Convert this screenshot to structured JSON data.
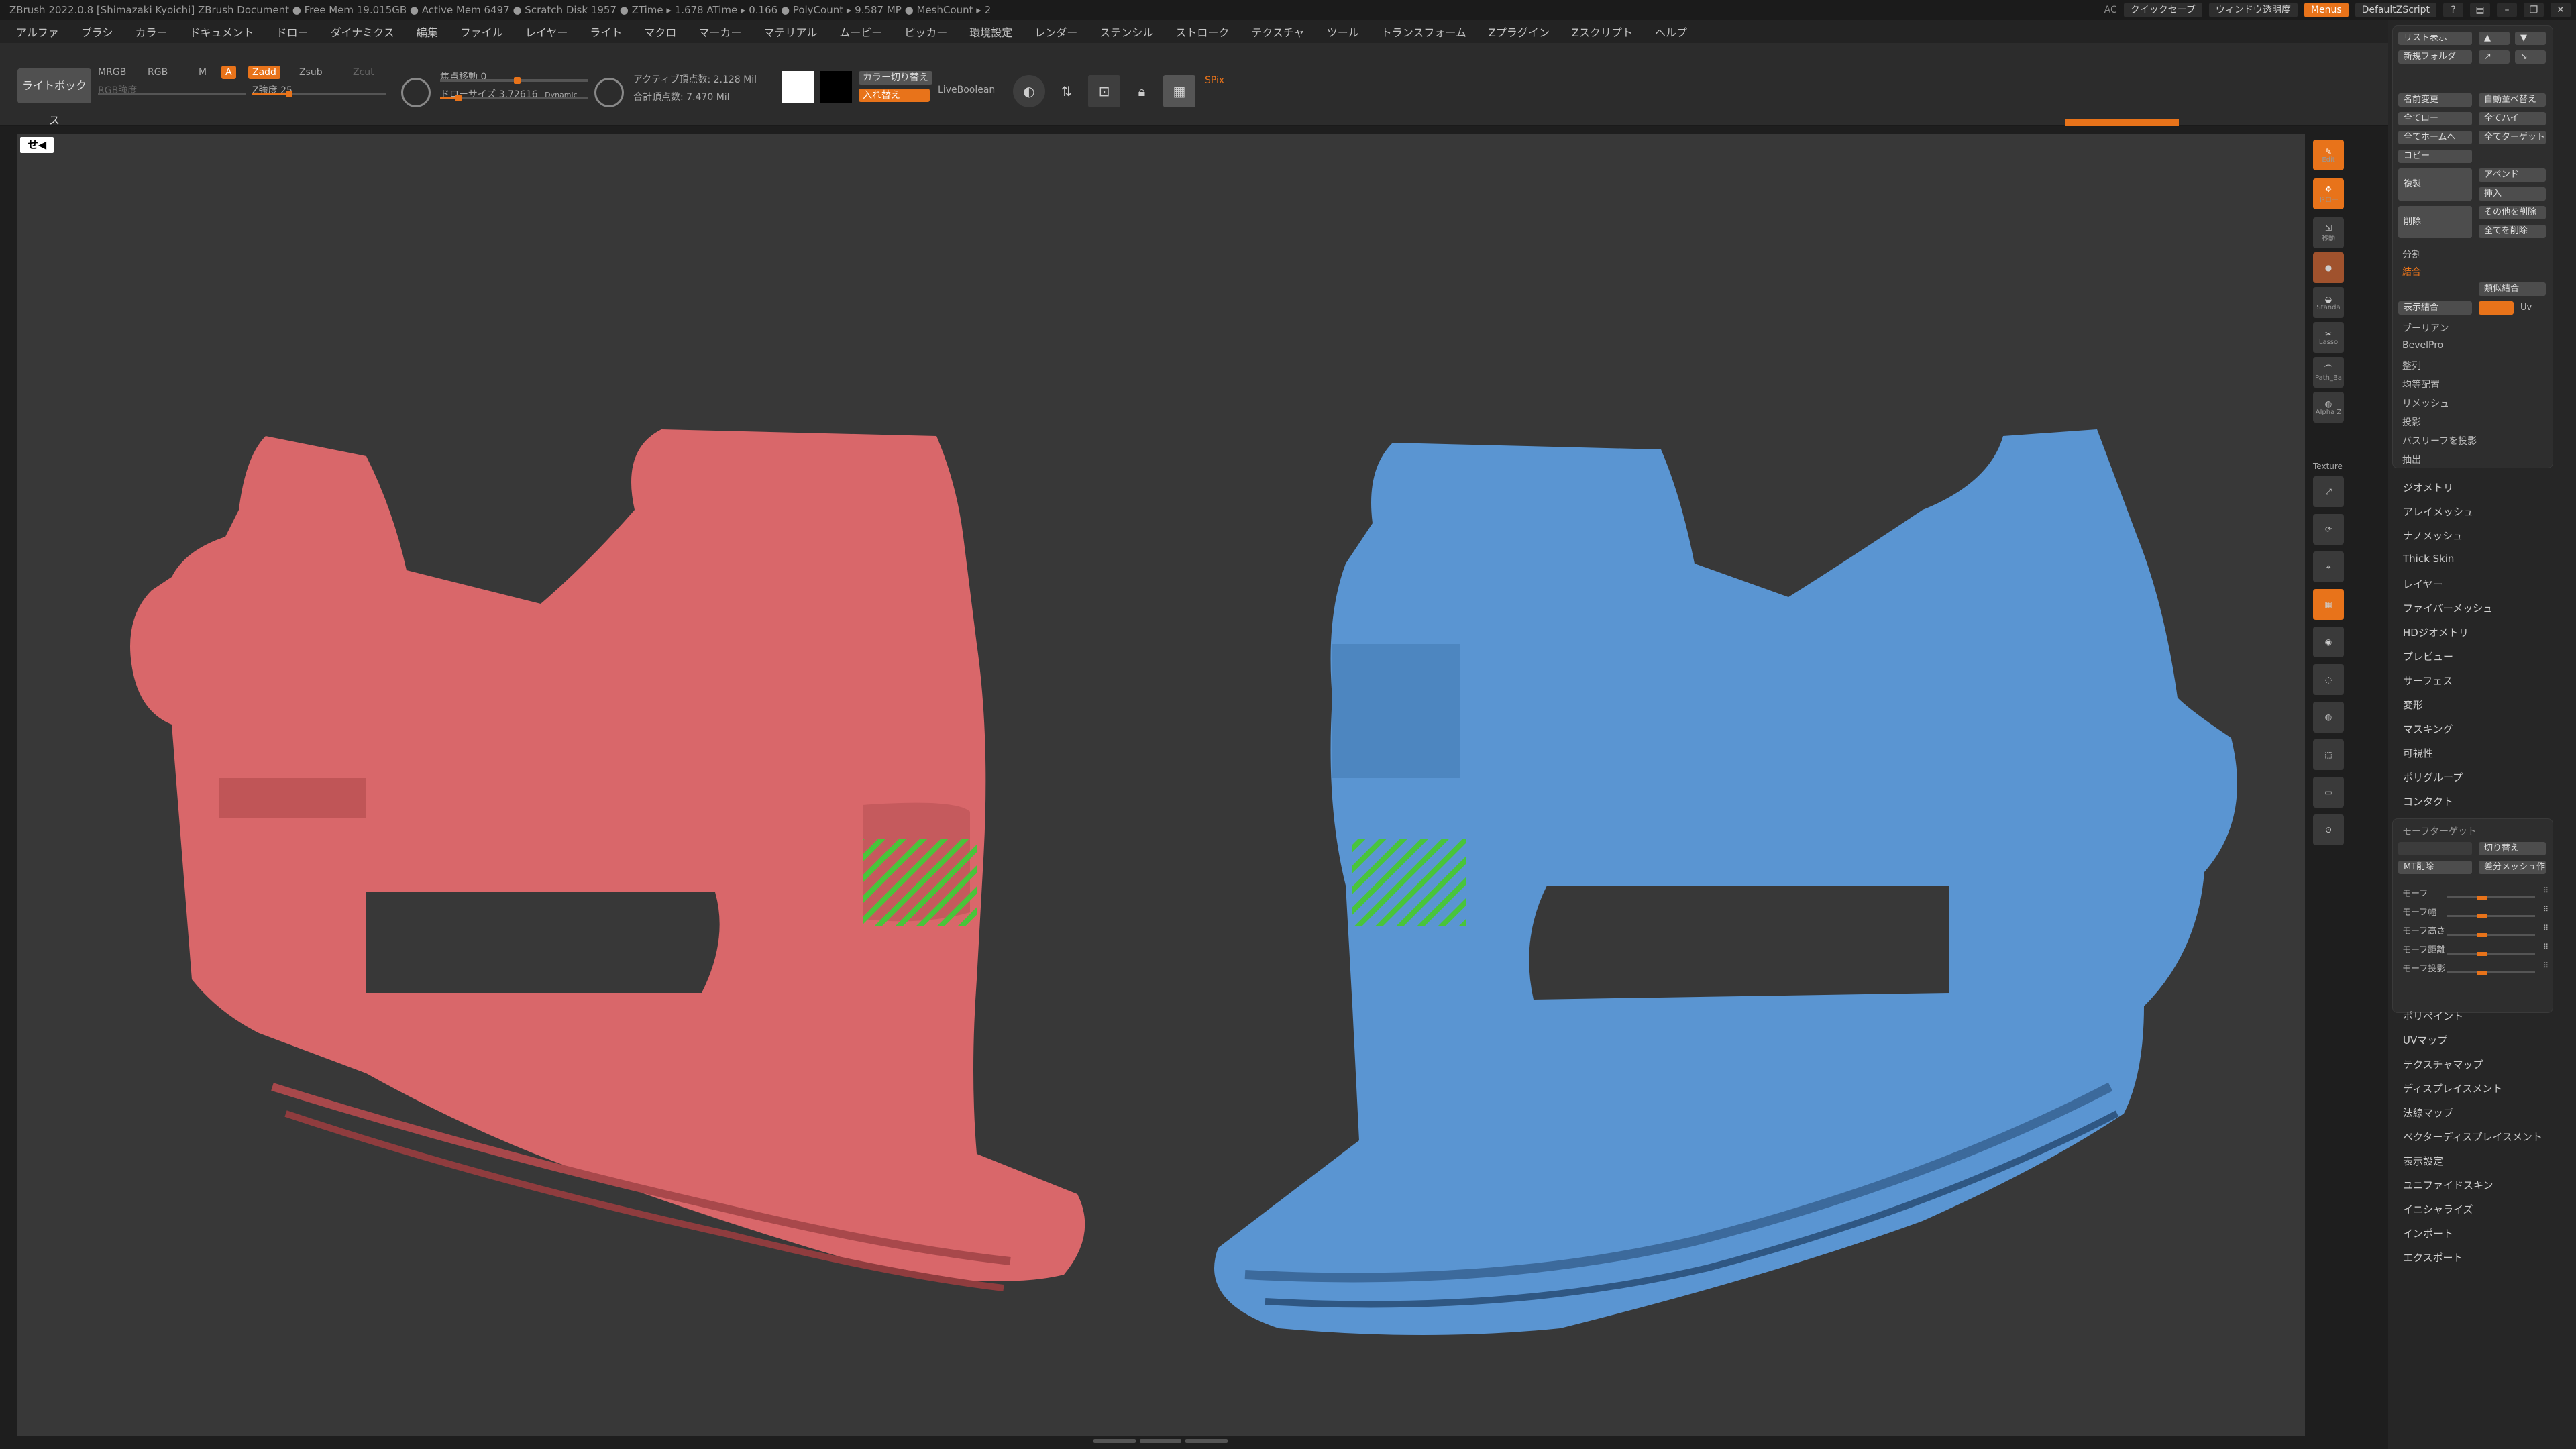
{
  "titlebar": {
    "text": "ZBrush 2022.0.8 [Shimazaki Kyoichi]   ZBrush Document   ● Free Mem 19.015GB ● Active Mem 6497 ● Scratch Disk 1957 ● ZTime ▸ 1.678 ATime ▸ 0.166 ● PolyCount ▸ 9.587 MP ● MeshCount ▸ 2",
    "ac": "AC",
    "quicksave": "クイックセーブ",
    "transparency": "ウィンドウ透明度",
    "menus": "Menus",
    "script": "DefaultZScript"
  },
  "menubar": [
    "アルファ",
    "ブラシ",
    "カラー",
    "ドキュメント",
    "ドロー",
    "ダイナミクス",
    "編集",
    "ファイル",
    "レイヤー",
    "ライト",
    "マクロ",
    "マーカー",
    "マテリアル",
    "ムービー",
    "ピッカー",
    "環境設定",
    "レンダー",
    "ステンシル",
    "ストローク",
    "テクスチャ",
    "ツール",
    "トランスフォーム",
    "Zプラグイン",
    "Zスクリプト",
    "ヘルプ"
  ],
  "toolbar": {
    "lightbox": "ライトボックス",
    "mrgb": "MRGB",
    "rgb": "RGB",
    "m": "M",
    "a": "A",
    "zadd": "Zadd",
    "zsub": "Zsub",
    "zcut": "Zcut",
    "rgb_intensity": "RGB強度",
    "z_intensity": "Z強度 25",
    "focal_shift": "焦点移動 0",
    "draw_size": "ドローサイズ 3.72616",
    "dynamic": "Dynamic",
    "active_points": "アクティブ頂点数: 2.128 Mil",
    "total_points": "合計頂点数: 7.470 Mil",
    "color_switch": "カラー切り替え",
    "swap": "入れ替え",
    "liveboolean": "LiveBoolean",
    "spix": "SPix",
    "z_intensity_value": 0.25,
    "focal_shift_value": 0.5,
    "draw_size_value": 0.1
  },
  "viewport": {
    "label": "せ◀"
  },
  "vtoolbar": [
    {
      "label": "Edit",
      "name": "edit-button"
    },
    {
      "label": "ドロー",
      "name": "draw-button"
    },
    {
      "label": "移動",
      "name": "move-button"
    },
    {
      "label": "",
      "name": "material-button"
    },
    {
      "label": "Standa",
      "name": "standard-brush-button"
    },
    {
      "label": "Lasso",
      "name": "lasso-button"
    },
    {
      "label": "Path_Ba",
      "name": "path-button"
    },
    {
      "label": "Alpha Z",
      "name": "alpha-button"
    }
  ],
  "vtoolbar_texture": "Texture",
  "rightpanel": {
    "list_view": "リスト表示",
    "new_folder": "新規フォルダ",
    "rename": "名前変更",
    "auto_sort": "自動並べ替え",
    "all_low": "全てロー",
    "all_high": "全てハイ",
    "all_home": "全てホームへ",
    "all_target": "全てターゲット",
    "copy": "コピー",
    "duplicate": "複製",
    "append": "アペンド",
    "insert": "挿入",
    "delete": "削除",
    "delete_others": "その他を削除",
    "delete_all": "全てを削除",
    "split": "分割",
    "merge": "結合",
    "merge_similar": "類似結合",
    "visible_merge": "表示結合",
    "uv": "Uv",
    "boolean": "ブーリアン",
    "bevelpro": "BevelPro",
    "align": "整列",
    "distribute": "均等配置",
    "remesh": "リメッシュ",
    "project": "投影",
    "project_bas": "バスリーフを投影",
    "extract": "抽出",
    "menus": [
      "ジオメトリ",
      "アレイメッシュ",
      "ナノメッシュ",
      "Thick Skin",
      "レイヤー",
      "ファイバーメッシュ",
      "HDジオメトリ",
      "プレビュー",
      "サーフェス",
      "変形",
      "マスキング",
      "可視性",
      "ポリグループ",
      "コンタクト"
    ],
    "morph_target": "モーフターゲット",
    "switch": "切り替え",
    "mt_delete": "MT削除",
    "diff_mesh": "差分メッシュ作",
    "morph_sliders": [
      {
        "label": "モーフ",
        "value": 0.35
      },
      {
        "label": "モーフ幅",
        "value": 0.35
      },
      {
        "label": "モーフ高さ",
        "value": 0.35
      },
      {
        "label": "モーフ距離",
        "value": 0.35
      },
      {
        "label": "モーフ投影",
        "value": 0.35
      }
    ],
    "menus2": [
      "ポリペイント",
      "UVマップ",
      "テクスチャマップ",
      "ディスプレイスメント",
      "法線マップ",
      "ベクターディスプレイスメント",
      "表示設定",
      "ユニファイドスキン",
      "イニシャライズ",
      "インポート",
      "エクスポート"
    ]
  },
  "colors": {
    "accent": "#e8731a",
    "red_mesh": "#d9676a",
    "blue_mesh": "#5a95d2",
    "hatch": "#49c43a"
  }
}
